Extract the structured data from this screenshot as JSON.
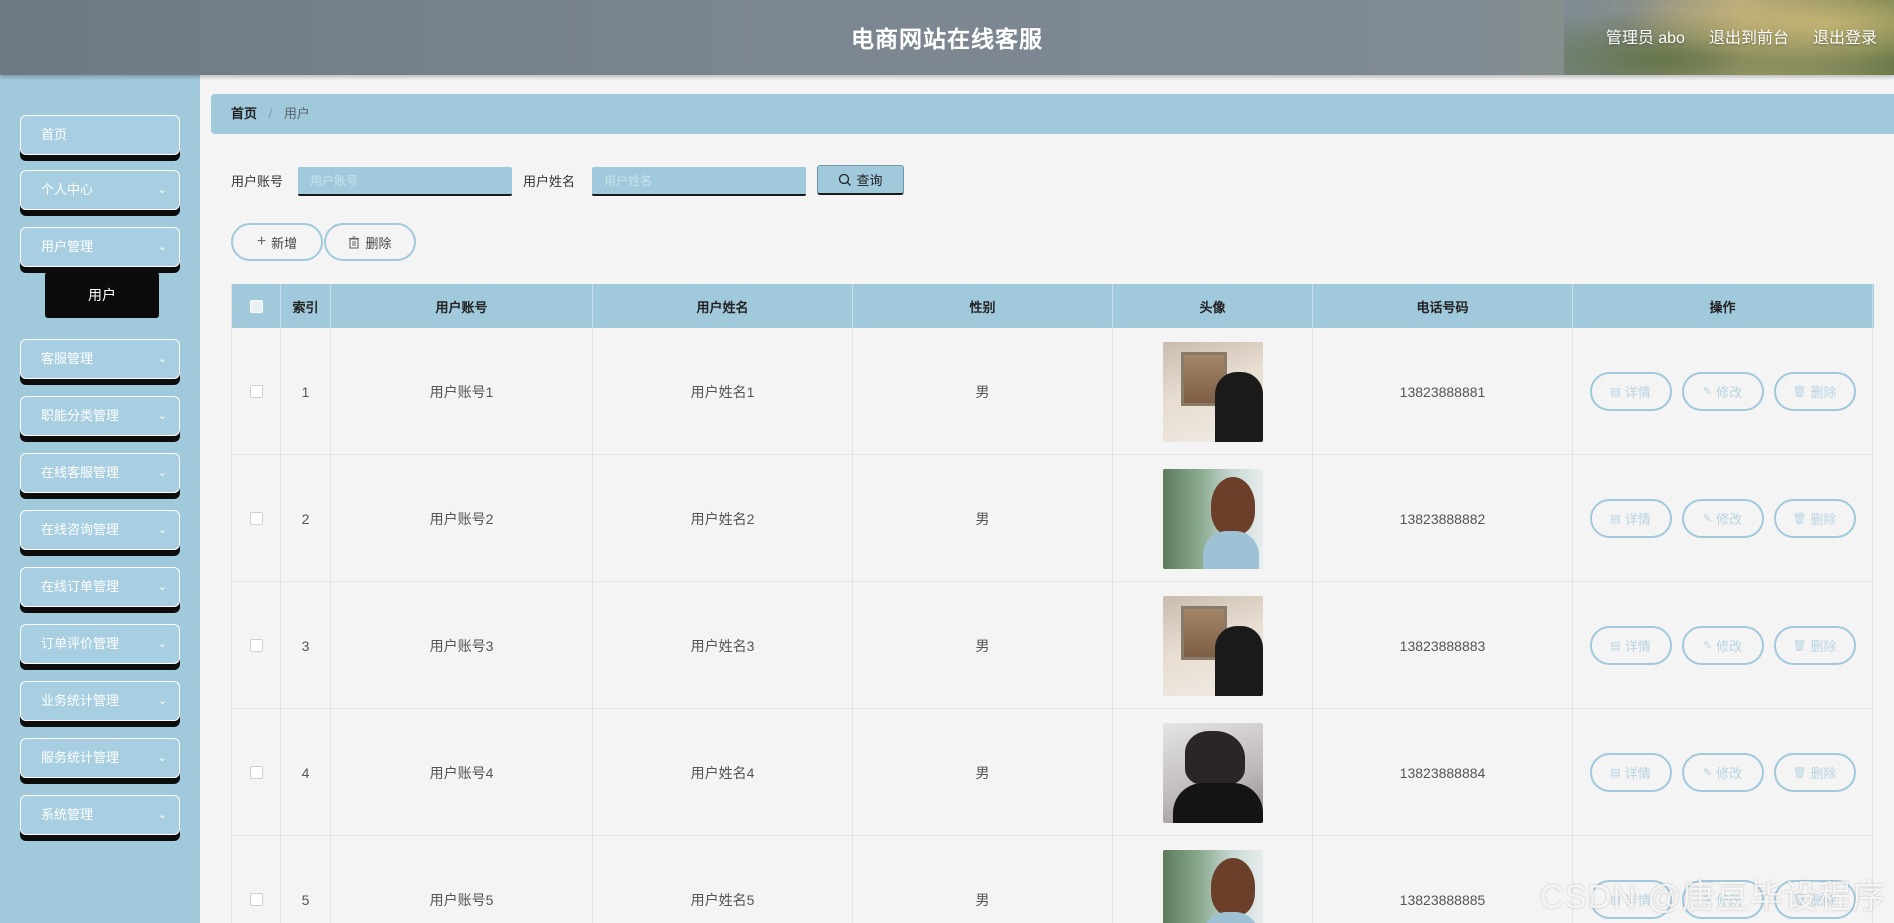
{
  "header": {
    "title": "电商网站在线客服",
    "admin_label": "管理员 abo",
    "front_link": "退出到前台",
    "logout_link": "退出登录"
  },
  "sidebar": {
    "items": [
      {
        "label": "首页",
        "has_arrow": false
      },
      {
        "label": "个人中心",
        "has_arrow": true
      },
      {
        "label": "用户管理",
        "has_arrow": true
      },
      {
        "label": "客服管理",
        "has_arrow": true
      },
      {
        "label": "职能分类管理",
        "has_arrow": true
      },
      {
        "label": "在线客服管理",
        "has_arrow": true
      },
      {
        "label": "在线咨询管理",
        "has_arrow": true
      },
      {
        "label": "在线订单管理",
        "has_arrow": true
      },
      {
        "label": "订单评价管理",
        "has_arrow": true
      },
      {
        "label": "业务统计管理",
        "has_arrow": true
      },
      {
        "label": "服务统计管理",
        "has_arrow": true
      },
      {
        "label": "系统管理",
        "has_arrow": true
      }
    ],
    "active_sub": "用户"
  },
  "breadcrumb": {
    "home": "首页",
    "separator": "/",
    "current": "用户"
  },
  "search": {
    "account_label": "用户账号",
    "account_placeholder": "用户账号",
    "name_label": "用户姓名",
    "name_placeholder": "用户姓名",
    "query_button": "查询"
  },
  "actions": {
    "add_button": "新增",
    "delete_button": "删除"
  },
  "table": {
    "columns": [
      "索引",
      "用户账号",
      "用户姓名",
      "性别",
      "头像",
      "电话号码",
      "操作"
    ],
    "op_labels": {
      "detail": "详情",
      "edit": "修改",
      "delete": "删除"
    },
    "rows": [
      {
        "index": "1",
        "account": "用户账号1",
        "name": "用户姓名1",
        "gender": "男",
        "avatar": "av-a",
        "phone": "13823888881"
      },
      {
        "index": "2",
        "account": "用户账号2",
        "name": "用户姓名2",
        "gender": "男",
        "avatar": "av-b",
        "phone": "13823888882"
      },
      {
        "index": "3",
        "account": "用户账号3",
        "name": "用户姓名3",
        "gender": "男",
        "avatar": "av-a",
        "phone": "13823888883"
      },
      {
        "index": "4",
        "account": "用户账号4",
        "name": "用户姓名4",
        "gender": "男",
        "avatar": "av-c",
        "phone": "13823888884"
      },
      {
        "index": "5",
        "account": "用户账号5",
        "name": "用户姓名5",
        "gender": "男",
        "avatar": "av-b",
        "phone": "13823888885"
      }
    ]
  },
  "watermark": "CSDN @唐豆毕设程序",
  "colors": {
    "accent": "#a1c9dc",
    "menu_shadow": "#0d0d0d",
    "background": "#f4f4f4"
  }
}
